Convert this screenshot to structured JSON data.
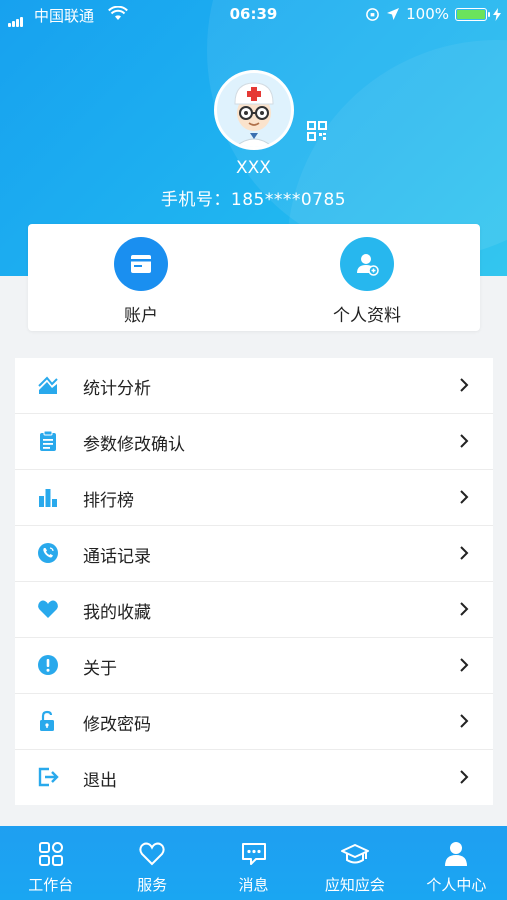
{
  "status_bar": {
    "carrier": "中国联通",
    "time": "06:39",
    "battery": "100%"
  },
  "profile": {
    "name": "XXX",
    "phone": "手机号：185****0785"
  },
  "quick_actions": [
    {
      "label": "账户",
      "icon": "account-card-icon",
      "color": "#1a8ff0"
    },
    {
      "label": "个人资料",
      "icon": "user-profile-icon",
      "color": "#27b7ee"
    }
  ],
  "menu": [
    {
      "label": "统计分析",
      "icon": "chart-line-icon"
    },
    {
      "label": "参数修改确认",
      "icon": "clipboard-icon"
    },
    {
      "label": "排行榜",
      "icon": "bar-chart-icon"
    },
    {
      "label": "通话记录",
      "icon": "phone-call-icon"
    },
    {
      "label": "我的收藏",
      "icon": "heart-icon"
    },
    {
      "label": "关于",
      "icon": "info-exclamation-icon"
    },
    {
      "label": "修改密码",
      "icon": "unlock-icon"
    },
    {
      "label": "退出",
      "icon": "logout-icon"
    }
  ],
  "tabs": [
    {
      "label": "工作台",
      "icon": "grid-icon"
    },
    {
      "label": "服务",
      "icon": "heart-outline-icon"
    },
    {
      "label": "消息",
      "icon": "message-icon"
    },
    {
      "label": "应知应会",
      "icon": "graduation-cap-icon"
    },
    {
      "label": "个人中心",
      "icon": "person-icon",
      "active": true
    }
  ],
  "colors": {
    "accent": "#1aa3ef",
    "icon_blue": "#29a9ec"
  }
}
